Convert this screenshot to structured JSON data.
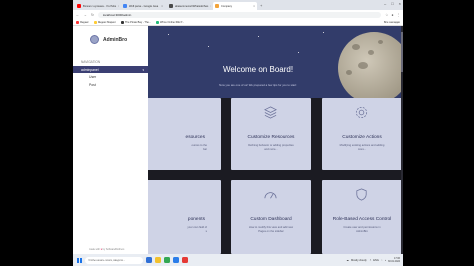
{
  "browser": {
    "tabs": [
      {
        "label": "Взлом с нуляшка - YouTube",
        "color": "#ff0000",
        "active": false
      },
      {
        "label": "Wolf.parse - Google Java",
        "color": "#4285f4",
        "active": false
      },
      {
        "label": "abatecomeme!IWhatsdo/Ses",
        "color": "#4a4a4a",
        "active": false
      },
      {
        "label": "Company",
        "color": "#f2a33a",
        "active": true
      }
    ],
    "new_tab": "+",
    "url": "localhost:3000/admin",
    "bookmarks": [
      {
        "label": "Яндекс",
        "color": "#f33"
      },
      {
        "label": "Яндекс Маркет",
        "color": "#fc3"
      },
      {
        "label": "The Pirate Bay - The...",
        "color": "#333"
      },
      {
        "label": "Whos Online IDE P...",
        "color": "#2b7"
      }
    ],
    "bookmarks_right": "Все закладки"
  },
  "sidebar": {
    "brand": "AdminBro",
    "nav_title": "NAVIGATION",
    "items": [
      {
        "label": "adminpanel",
        "active": true,
        "arrow": "▾"
      },
      {
        "label": "User",
        "active": false
      },
      {
        "label": "Post",
        "active": false
      }
    ],
    "made_with": "made with",
    "made_by": "by SoftwareBrothers"
  },
  "hero": {
    "title": "Welcome on Board!",
    "subtitle": "Now you are one of us! We prepared a few tips for you to start:"
  },
  "cards": [
    {
      "title": "esources",
      "desc_lines": [
        "ources to the",
        "bar"
      ],
      "icon": "cube-icon",
      "cut": true
    },
    {
      "title": "Customize Resources",
      "desc_lines": [
        "Defining behavior or adding properties",
        "and more..."
      ],
      "icon": "layers-icon",
      "cut": false
    },
    {
      "title": "Customize Actions",
      "desc_lines": [
        "Modifying existing actions and adding",
        "more..."
      ],
      "icon": "gear-icon",
      "cut": false
    },
    {
      "title": "ponents",
      "desc_lines": [
        "your own field of",
        "s"
      ],
      "icon": "puzzle-icon",
      "cut": true
    },
    {
      "title": "Custom Dashboard",
      "desc_lines": [
        "How to modify this view and add new",
        "Pages on the sidebar"
      ],
      "icon": "dashboard-icon",
      "cut": false
    },
    {
      "title": "Role-Based Access Control",
      "desc_lines": [
        "Create user and permissions in",
        "AdminBro"
      ],
      "icon": "shield-icon",
      "cut": false
    }
  ],
  "taskbar": {
    "search_placeholder": "Чтобы начать поиск, введите...",
    "weather": "Mostly cloudy",
    "clock_time": "17:06",
    "clock_date": "30.01.2024",
    "lang": "ENG"
  }
}
